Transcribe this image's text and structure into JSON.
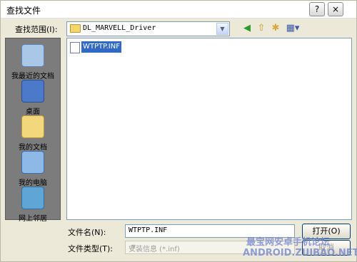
{
  "window": {
    "title": "查找文件",
    "help_button": "?",
    "close_button": "×"
  },
  "lookin": {
    "label": "查找范围(I):",
    "value": "DL_MARVELL_Driver"
  },
  "toolbar_icons": [
    "back-icon",
    "up-folder-icon",
    "new-folder-icon",
    "view-menu-icon"
  ],
  "places": [
    {
      "label": "我最近的文档",
      "icon": "recent-documents-icon"
    },
    {
      "label": "桌面",
      "icon": "desktop-icon"
    },
    {
      "label": "我的文档",
      "icon": "my-documents-icon"
    },
    {
      "label": "我的电脑",
      "icon": "my-computer-icon"
    },
    {
      "label": "网上邻居",
      "icon": "network-places-icon"
    }
  ],
  "files": [
    {
      "name": "WTPTP.INF",
      "selected": true
    }
  ],
  "filename": {
    "label": "文件名(N):",
    "value": "WTPTP.INF"
  },
  "filetype": {
    "label": "文件类型(T):",
    "value": "安装信息 (*.inf)"
  },
  "buttons": {
    "open": "打开(O)",
    "cancel": "取消"
  },
  "watermark": {
    "line1": "最宝网安卓手机论坛",
    "line2": "ANDROID.ZUIBAO.NET"
  }
}
